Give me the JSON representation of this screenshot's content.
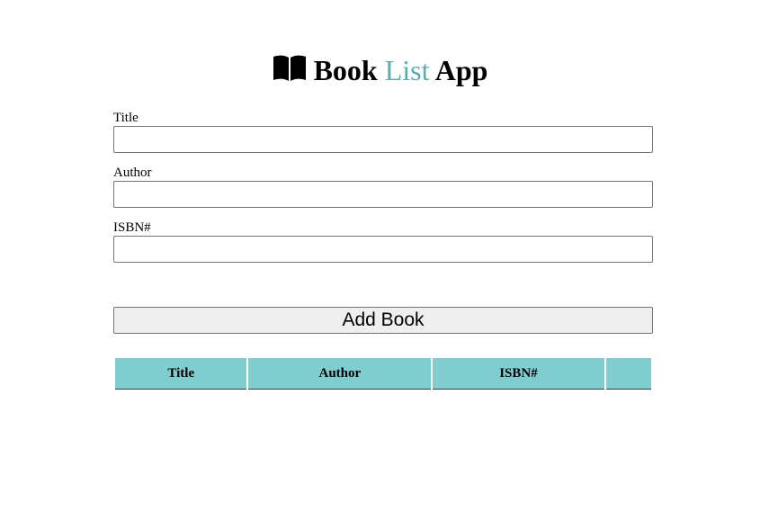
{
  "header": {
    "icon": "open-book-icon",
    "title_part1": "Book",
    "title_accent": "List",
    "title_part2": "App",
    "accent_color": "#5aaeb0"
  },
  "form": {
    "title_label": "Title",
    "title_value": "",
    "author_label": "Author",
    "author_value": "",
    "isbn_label": "ISBN#",
    "isbn_value": "",
    "submit_label": "Add Book"
  },
  "table": {
    "header_color": "#80cdd0",
    "columns": [
      "Title",
      "Author",
      "ISBN#",
      ""
    ],
    "rows": []
  }
}
